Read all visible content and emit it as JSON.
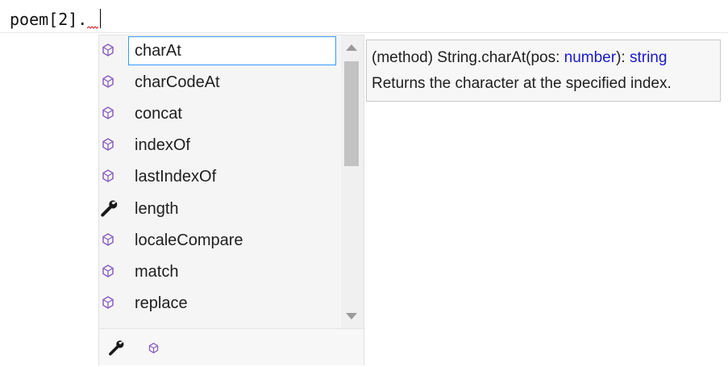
{
  "editor": {
    "code": "poem[2]."
  },
  "completion": {
    "items": [
      {
        "label": "charAt",
        "kind": "method-icon",
        "selected": true
      },
      {
        "label": "charCodeAt",
        "kind": "method-icon"
      },
      {
        "label": "concat",
        "kind": "method-icon"
      },
      {
        "label": "indexOf",
        "kind": "method-icon"
      },
      {
        "label": "lastIndexOf",
        "kind": "method-icon"
      },
      {
        "label": "length",
        "kind": "property-wrench-icon"
      },
      {
        "label": "localeCompare",
        "kind": "method-icon"
      },
      {
        "label": "match",
        "kind": "method-icon"
      },
      {
        "label": "replace",
        "kind": "method-icon"
      }
    ]
  },
  "tooltip": {
    "sig_prefix": "(method) String.charAt(pos: ",
    "sig_param_type": "number",
    "sig_middle": "): ",
    "sig_return_type": "string",
    "description": "Returns the character at the specified index."
  },
  "colors": {
    "selection_border": "#3399ff",
    "method_icon": "#8a5fbf",
    "type_keyword": "#1a1acc"
  }
}
